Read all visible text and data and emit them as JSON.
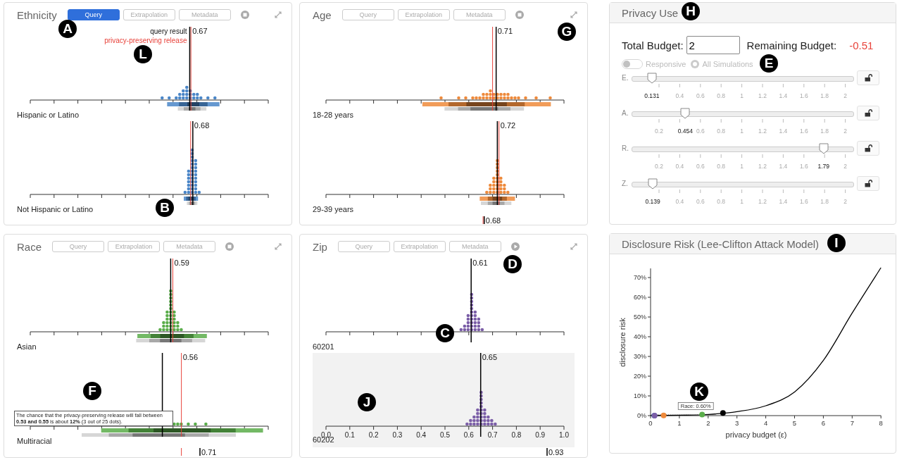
{
  "panels": [
    {
      "title": "Ethnicity",
      "color": "#4a86c8",
      "simulated": true,
      "buttons": [
        {
          "label": "Query",
          "selected": true
        },
        {
          "label": "Extrapolation",
          "selected": false
        },
        {
          "label": "Metadata",
          "selected": false
        }
      ],
      "legend": {
        "query": "query result",
        "release": "privacy-preserving release"
      },
      "groups": [
        {
          "label": "Hispanic or Latino",
          "value": "0.67",
          "highlighted": false
        },
        {
          "label": "Not Hispanic or Latino",
          "value": "0.68",
          "highlighted": false
        }
      ]
    },
    {
      "title": "Age",
      "color": "#ee8a3c",
      "simulated": true,
      "buttons": [
        {
          "label": "Query",
          "selected": false
        },
        {
          "label": "Extrapolation",
          "selected": false
        },
        {
          "label": "Metadata",
          "selected": false
        }
      ],
      "groups": [
        {
          "label": "18-28 years",
          "value": "0.71",
          "highlighted": false
        },
        {
          "label": "29-39 years",
          "value": "0.72",
          "highlighted": false
        }
      ],
      "peek_value": "0.68"
    },
    {
      "title": "Race",
      "color": "#5aad4a",
      "simulated": true,
      "buttons": [
        {
          "label": "Query",
          "selected": false
        },
        {
          "label": "Extrapolation",
          "selected": false
        },
        {
          "label": "Metadata",
          "selected": false
        }
      ],
      "groups": [
        {
          "label": "Asian",
          "value": "0.59",
          "highlighted": false
        },
        {
          "label": "Multiracial",
          "value": "0.56",
          "highlighted": false,
          "tooltip": "The chance that the privacy-preserving release will fall between **0.53 and 0.55** is about **12%** (3 out of 25 dots)."
        }
      ],
      "peek_value": "0.71"
    },
    {
      "title": "Zip",
      "color": "#7b5ea7",
      "simulated": false,
      "buttons": [
        {
          "label": "Query",
          "selected": false
        },
        {
          "label": "Extrapolation",
          "selected": false
        },
        {
          "label": "Metadata",
          "selected": false
        }
      ],
      "groups": [
        {
          "label": "60201",
          "value": "0.61",
          "highlighted": false
        },
        {
          "label": "60202",
          "value": "0.65",
          "highlighted": true,
          "axis_labels": [
            "0.0",
            "0.1",
            "0.2",
            "0.3",
            "0.4",
            "0.5",
            "0.6",
            "0.7",
            "0.8",
            "0.9",
            "1.0"
          ]
        }
      ],
      "peek_value": "0.93"
    }
  ],
  "privacy_use": {
    "title": "Privacy Use",
    "total_budget_label": "Total Budget:",
    "total_budget": "2",
    "remaining_label": "Remaining Budget:",
    "remaining": "-0.51",
    "responsive": {
      "label": "Responsive",
      "on": false,
      "disabled": true
    },
    "all_simulations": {
      "label": "All Simulations",
      "checked": false,
      "disabled": true
    },
    "sliders": [
      {
        "label": "E.",
        "level": 0.0655,
        "ticks": [
          {
            "text": "0.131",
            "current": true
          },
          {
            "text": "0.4",
            "current": false
          },
          {
            "text": "0.6",
            "current": false
          },
          {
            "text": "0.8",
            "current": false
          },
          {
            "text": "1",
            "current": false
          },
          {
            "text": "1.2",
            "current": false
          },
          {
            "text": "1.4",
            "current": false
          },
          {
            "text": "1.6",
            "current": false
          },
          {
            "text": "1.8",
            "current": false
          },
          {
            "text": "2",
            "current": false
          }
        ]
      },
      {
        "label": "A.",
        "level": 0.227,
        "ticks": [
          {
            "text": "0.2",
            "current": false
          },
          {
            "text": "0.454",
            "current": true
          },
          {
            "text": "0.6",
            "current": false
          },
          {
            "text": "0.8",
            "current": false
          },
          {
            "text": "1",
            "current": false
          },
          {
            "text": "1.2",
            "current": false
          },
          {
            "text": "1.4",
            "current": false
          },
          {
            "text": "1.6",
            "current": false
          },
          {
            "text": "1.8",
            "current": false
          },
          {
            "text": "2",
            "current": false
          }
        ]
      },
      {
        "label": "R.",
        "level": 0.895,
        "ticks": [
          {
            "text": "0.2",
            "current": false
          },
          {
            "text": "0.4",
            "current": false
          },
          {
            "text": "0.6",
            "current": false
          },
          {
            "text": "0.8",
            "current": false
          },
          {
            "text": "1",
            "current": false
          },
          {
            "text": "1.2",
            "current": false
          },
          {
            "text": "1.4",
            "current": false
          },
          {
            "text": "1.6",
            "current": false
          },
          {
            "text": "1.79",
            "current": true
          },
          {
            "text": "2",
            "current": false
          }
        ]
      },
      {
        "label": "Z.",
        "level": 0.0695,
        "ticks": [
          {
            "text": "0.139",
            "current": true
          },
          {
            "text": "0.4",
            "current": false
          },
          {
            "text": "0.6",
            "current": false
          },
          {
            "text": "0.8",
            "current": false
          },
          {
            "text": "1",
            "current": false
          },
          {
            "text": "1.2",
            "current": false
          },
          {
            "text": "1.4",
            "current": false
          },
          {
            "text": "1.6",
            "current": false
          },
          {
            "text": "1.8",
            "current": false
          },
          {
            "text": "2",
            "current": false
          }
        ]
      }
    ]
  },
  "disclosure_risk": {
    "title": "Disclosure Risk (Lee-Clifton Attack Model)",
    "chart_data": {
      "type": "line",
      "xlabel": "privacy budget (ε)",
      "ylabel": "disclosure risk",
      "x": [
        0,
        1,
        2,
        3,
        4,
        5,
        6,
        7,
        8
      ],
      "series": [
        {
          "color": "#000000",
          "values": [
            0,
            0.2,
            0.6,
            2,
            5,
            12,
            28,
            52,
            75
          ]
        }
      ],
      "xlim": [
        0,
        8
      ],
      "ylim": [
        0,
        75
      ],
      "xticks": [
        0,
        1,
        2,
        3,
        4,
        5,
        6,
        7,
        8
      ],
      "yticks": [
        {
          "value": 0,
          "label": "0%"
        },
        {
          "value": 10,
          "label": "10%"
        },
        {
          "value": 20,
          "label": "20%"
        },
        {
          "value": 30,
          "label": "30%"
        },
        {
          "value": 40,
          "label": "40%"
        },
        {
          "value": 50,
          "label": "50%"
        },
        {
          "value": 60,
          "label": "60%"
        },
        {
          "value": 70,
          "label": "70%"
        }
      ],
      "annotations": [
        {
          "text": "Race: 0.60%"
        }
      ]
    }
  },
  "callouts": [
    "A",
    "L",
    "B",
    "G",
    "C",
    "D",
    "F",
    "J",
    "H",
    "E",
    "I",
    "K"
  ]
}
